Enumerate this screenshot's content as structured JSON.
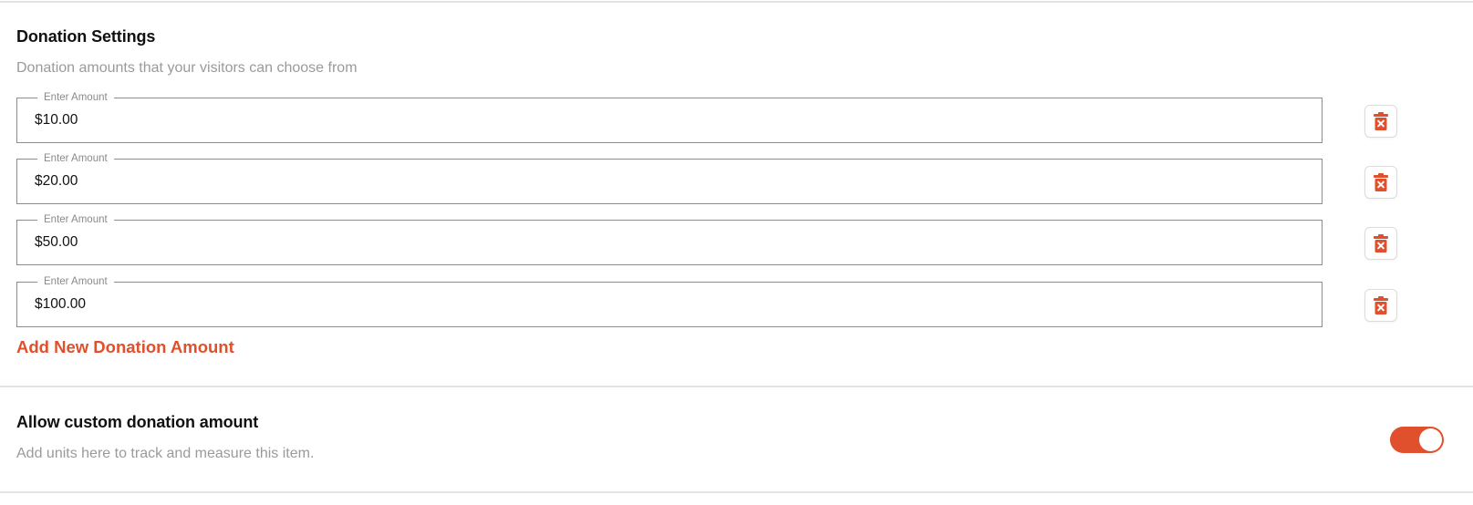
{
  "colors": {
    "accent": "#e0502c",
    "divider": "#e3e3e3",
    "muted_text": "#9a9a9a"
  },
  "donation_settings": {
    "title": "Donation Settings",
    "description": "Donation amounts that your visitors can choose from",
    "field_label": "Enter Amount",
    "amounts": [
      {
        "label": "Enter Amount",
        "value": "$10.00",
        "delete_icon": "trash-x-icon"
      },
      {
        "label": "Enter Amount",
        "value": "$20.00",
        "delete_icon": "trash-x-icon"
      },
      {
        "label": "Enter Amount",
        "value": "$50.00",
        "delete_icon": "trash-x-icon"
      },
      {
        "label": "Enter Amount",
        "value": "$100.00",
        "delete_icon": "trash-x-icon"
      }
    ],
    "add_label": "Add New Donation Amount"
  },
  "custom_amount": {
    "title": "Allow custom donation amount",
    "description": "Add units here to track and measure this item.",
    "toggle_on": true
  }
}
